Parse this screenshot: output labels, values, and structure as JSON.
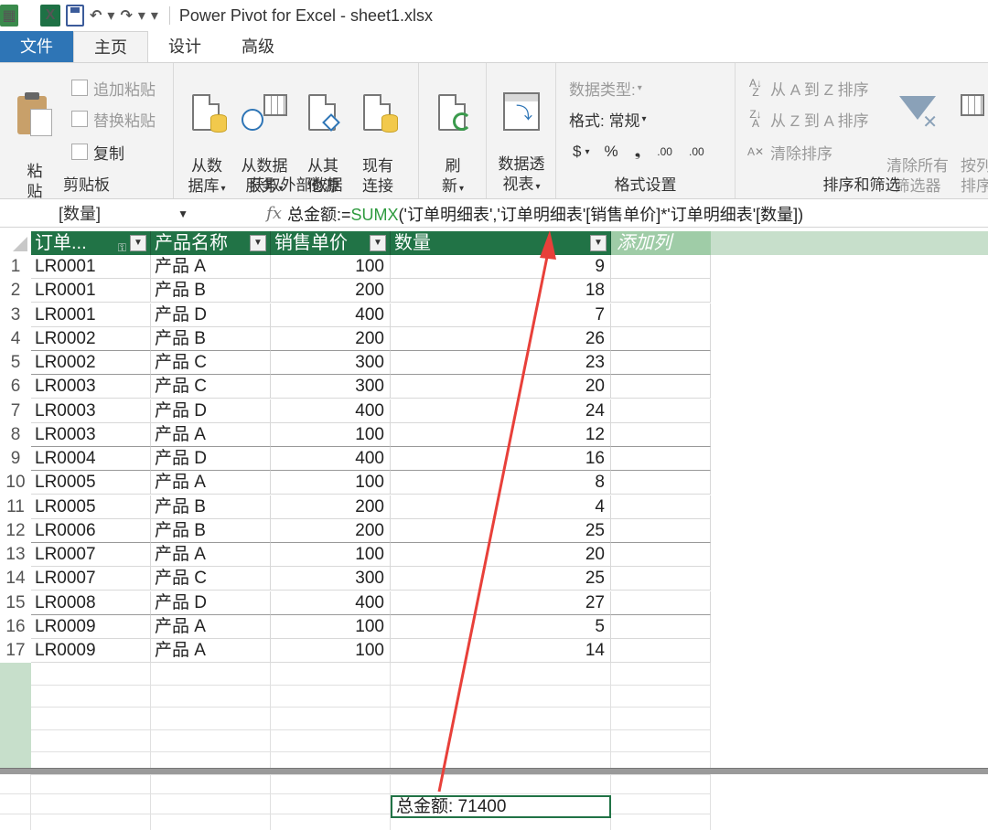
{
  "window": {
    "title": "Power Pivot for Excel - sheet1.xlsx"
  },
  "tabs": [
    {
      "label": "文件"
    },
    {
      "label": "主页"
    },
    {
      "label": "设计"
    },
    {
      "label": "高级"
    }
  ],
  "ribbon": {
    "clipboard": {
      "label": "剪贴板",
      "paste": "粘\n贴",
      "append_paste": "追加粘贴",
      "replace_paste": "替换粘贴",
      "copy": "复制"
    },
    "external": {
      "label": "获取外部数据",
      "from_db": "从数\n据库",
      "from_service": "从数据\n服务",
      "from_other": "从其\n他源",
      "existing": "现有\n连接"
    },
    "refresh": {
      "label": "刷\n新"
    },
    "pivot": {
      "label": "数据透\n视表"
    },
    "format": {
      "label": "格式设置",
      "data_type": "数据类型:",
      "format": "格式: 常规",
      "currency": "$",
      "percent": "%",
      "comma": "❟",
      "inc_decimal": ".00",
      "dec_decimal": ".00"
    },
    "sort": {
      "label": "排序和筛选",
      "asc": "从 A 到 Z 排序",
      "desc": "从 Z 到 A 排序",
      "clear_sort": "清除排序",
      "clear_filters": "清除所有\n筛选器",
      "sort_by": "按列\n排序"
    }
  },
  "formula_bar": {
    "name_box": "[数量]",
    "fx": "fx",
    "formula_prefix": "总金额:=",
    "formula_fn": "SUMX",
    "formula_rest": "('订单明细表','订单明细表'[销售单价]*'订单明细表'[数量])"
  },
  "table": {
    "columns": [
      "订单...",
      "产品名称",
      "销售单价",
      "数量"
    ],
    "add_column": "添加列",
    "rows": [
      [
        "1",
        "LR0001",
        "产品 A",
        "100",
        "9"
      ],
      [
        "2",
        "LR0001",
        "产品 B",
        "200",
        "18"
      ],
      [
        "3",
        "LR0001",
        "产品 D",
        "400",
        "7"
      ],
      [
        "4",
        "LR0002",
        "产品 B",
        "200",
        "26"
      ],
      [
        "5",
        "LR0002",
        "产品 C",
        "300",
        "23"
      ],
      [
        "6",
        "LR0003",
        "产品 C",
        "300",
        "20"
      ],
      [
        "7",
        "LR0003",
        "产品 D",
        "400",
        "24"
      ],
      [
        "8",
        "LR0003",
        "产品 A",
        "100",
        "12"
      ],
      [
        "9",
        "LR0004",
        "产品 D",
        "400",
        "16"
      ],
      [
        "10",
        "LR0005",
        "产品 A",
        "100",
        "8"
      ],
      [
        "11",
        "LR0005",
        "产品 B",
        "200",
        "4"
      ],
      [
        "12",
        "LR0006",
        "产品 B",
        "200",
        "25"
      ],
      [
        "13",
        "LR0007",
        "产品 A",
        "100",
        "20"
      ],
      [
        "14",
        "LR0007",
        "产品 C",
        "300",
        "25"
      ],
      [
        "15",
        "LR0008",
        "产品 D",
        "400",
        "27"
      ],
      [
        "16",
        "LR0009",
        "产品 A",
        "100",
        "5"
      ],
      [
        "17",
        "LR0009",
        "产品 A",
        "100",
        "14"
      ]
    ]
  },
  "measure": {
    "text": "总金额: 71400"
  },
  "colors": {
    "header_green": "#217346",
    "accent_blue": "#2e75b6",
    "arrow_red": "#e8403a"
  }
}
